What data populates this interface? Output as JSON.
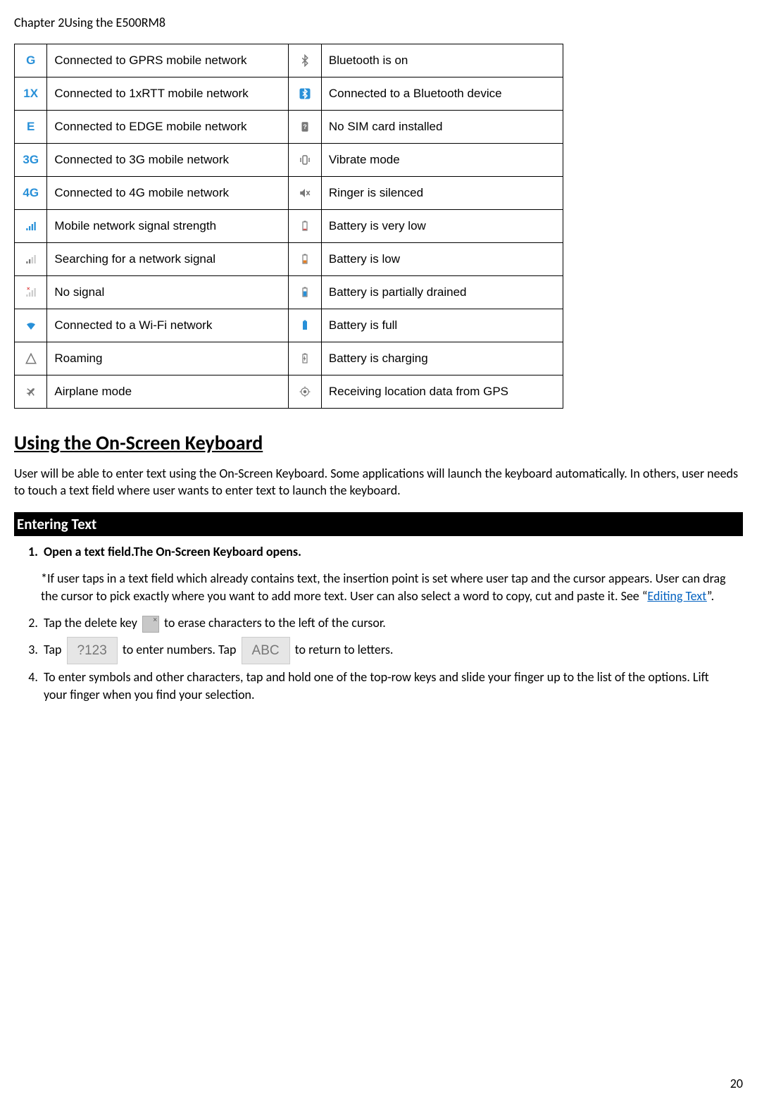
{
  "header": "Chapter 2Using the E500RM8",
  "table_rows": [
    {
      "left_icon_text": "G",
      "left_icon_class": "blue-text",
      "left_desc": "Connected to GPRS mobile network",
      "right_icon": "bluetooth",
      "right_desc": "Bluetooth is on"
    },
    {
      "left_icon_text": "1X",
      "left_icon_class": "blue-text",
      "left_desc": "Connected to 1xRTT mobile network",
      "right_icon": "bluetooth-conn",
      "right_desc": "Connected to a Bluetooth device"
    },
    {
      "left_icon_text": "E",
      "left_icon_class": "blue-text",
      "left_desc": "Connected to EDGE mobile network",
      "right_icon": "no-sim",
      "right_desc": "No SIM card installed"
    },
    {
      "left_icon_text": "3G",
      "left_icon_class": "blue-text",
      "left_desc": "Connected to 3G mobile network",
      "right_icon": "vibrate",
      "right_desc": "Vibrate mode"
    },
    {
      "left_icon_text": "4G",
      "left_icon_class": "blue-text",
      "left_desc": "Connected to 4G mobile network",
      "right_icon": "silent",
      "right_desc": "Ringer is silenced"
    },
    {
      "left_icon": "signal",
      "left_desc": "Mobile network signal strength",
      "right_icon": "battery-vlow",
      "right_desc": "Battery is very low"
    },
    {
      "left_icon": "signal-search",
      "left_desc": "Searching for a network signal",
      "right_icon": "battery-low",
      "right_desc": "Battery is low"
    },
    {
      "left_icon": "no-signal",
      "left_desc": "No signal",
      "right_icon": "battery-part",
      "right_desc": "Battery is partially drained"
    },
    {
      "left_icon": "wifi",
      "left_desc": "Connected to a Wi-Fi network",
      "right_icon": "battery-full",
      "right_desc": "Battery is full"
    },
    {
      "left_icon": "roaming",
      "left_desc": "Roaming",
      "right_icon": "battery-chg",
      "right_desc": "Battery is charging"
    },
    {
      "left_icon": "airplane",
      "left_desc": "Airplane mode",
      "right_icon": "gps",
      "right_desc": "Receiving location data from GPS"
    }
  ],
  "section_heading": "Using the On-Screen Keyboard",
  "section_body": "User will be able to enter text using the On-Screen Keyboard. Some applications will launch the keyboard automatically. In others, user needs to touch a text field where user wants to enter text to launch the keyboard.",
  "subheader": "Entering Text",
  "steps": {
    "s1": "Open a text field.The On-Screen Keyboard opens.",
    "note_pre": "*If user taps in a text field which already contains text, the insertion point is set where user tap and the cursor appears. User can drag the cursor to pick exactly where you want to add more text. User can also select a word to copy, cut and paste it. See “",
    "note_link": "Editing Text",
    "note_post": "”.",
    "s2a": "Tap the delete key ",
    "s2b": " to erase characters to the left of the cursor.",
    "s3a": "Tap ",
    "s3_key1": "?123",
    "s3b": " to enter numbers. Tap ",
    "s3_key2": "ABC",
    "s3c": " to return to letters.",
    "s4": "To enter symbols and other characters, tap and hold one of the top-row keys and slide your finger up to the list of the options. Lift your finger when you find your selection."
  },
  "page_number": "20"
}
